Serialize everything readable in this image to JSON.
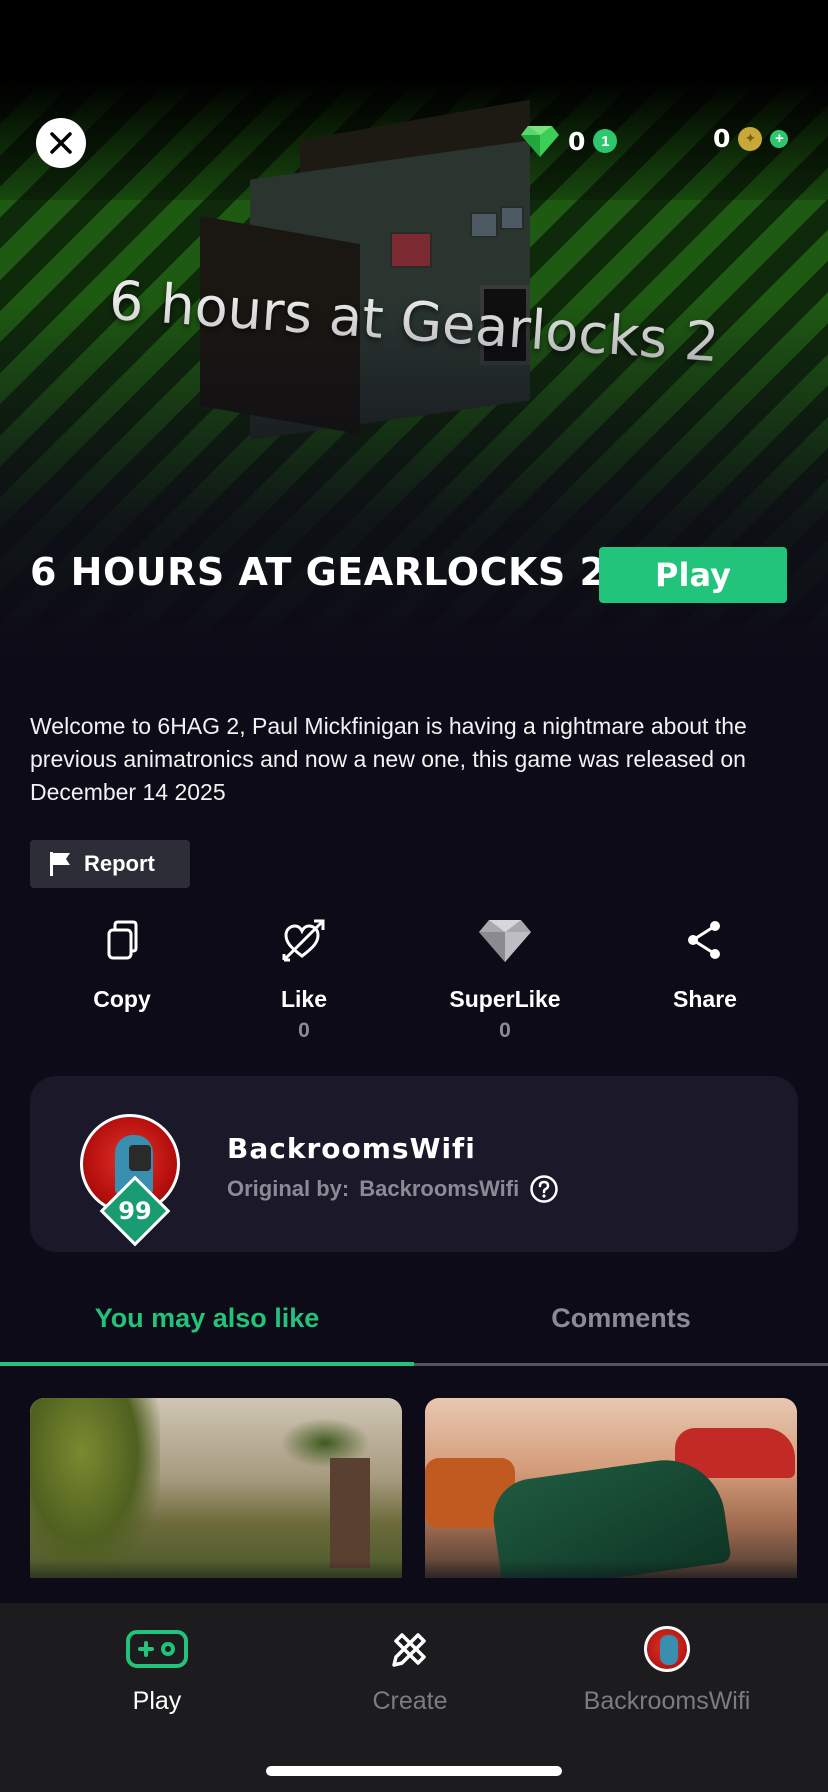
{
  "header": {
    "gems_count": "0",
    "gems_badge": "1",
    "coins_count": "0",
    "coins_badge": "+"
  },
  "hero": {
    "banner_text": "6 hours at Gearlocks 2",
    "game_title": "6 HOURS AT GEARLOCKS 2",
    "play_label": "Play"
  },
  "description": "Welcome to 6HAG 2, Paul Mickfinigan is having a nightmare about the previous animatronics and now a new one, this game was released on December 14 2025",
  "report_label": "Report",
  "actions": {
    "copy": {
      "label": "Copy"
    },
    "like": {
      "label": "Like",
      "count": "0"
    },
    "superlike": {
      "label": "SuperLike",
      "count": "0"
    },
    "share": {
      "label": "Share"
    }
  },
  "creator": {
    "name": "BackroomsWifi",
    "level": "99",
    "original_by_label": "Original by:",
    "original_by_name": "BackroomsWifi"
  },
  "tabs": [
    {
      "label": "You may also like",
      "active": true
    },
    {
      "label": "Comments",
      "active": false
    }
  ],
  "bottom_nav": [
    {
      "label": "Play",
      "icon": "gamepad-icon",
      "active": true
    },
    {
      "label": "Create",
      "icon": "pencil-ruler-icon",
      "active": false
    },
    {
      "label": "BackroomsWifi",
      "icon": "avatar",
      "active": false
    }
  ],
  "colors": {
    "accent": "#21c47a",
    "background": "#0d0b17",
    "card": "#1a1829",
    "muted": "#8b8b95"
  }
}
